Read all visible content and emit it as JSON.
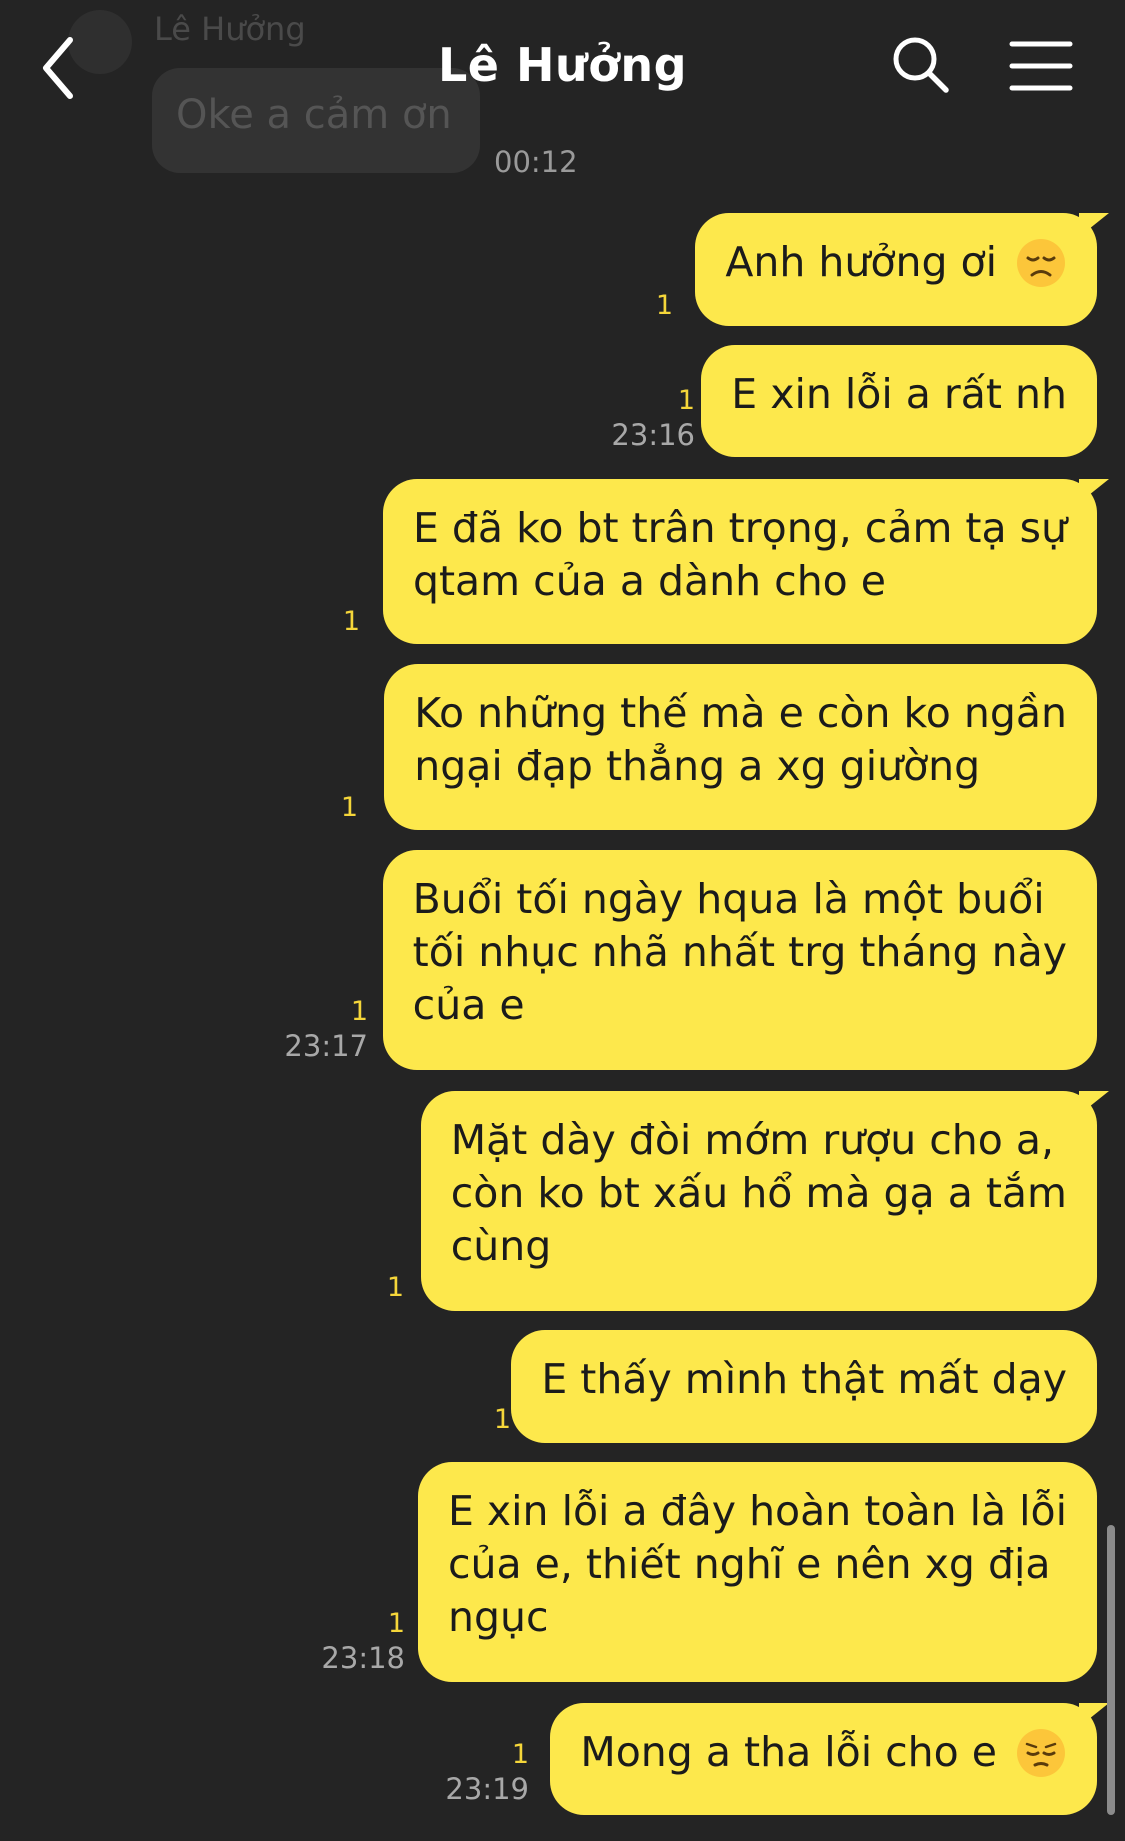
{
  "header": {
    "title": "Lê Hưởng",
    "back_icon": "chevron-left-icon",
    "search_icon": "search-icon",
    "menu_icon": "hamburger-menu-icon"
  },
  "previous_incoming": {
    "sender": "Lê Hưởng",
    "text": "Oke a cảm ơn",
    "time": "00:12"
  },
  "colors": {
    "background": "#242424",
    "outgoing_bubble": "#fde84c",
    "unread_count": "#f5d63a",
    "timestamp": "#a8a8a8"
  },
  "messages": [
    {
      "lines": [
        "Anh hưởng ơi"
      ],
      "emoji": "disappointed-face-emoji",
      "unread": "1",
      "time": ""
    },
    {
      "lines": [
        "E xin lỗi a rất nh"
      ],
      "unread": "1",
      "time": "23:16"
    },
    {
      "lines": [
        "E đã ko bt trân trọng, cảm tạ sự",
        "qtam của a dành cho e"
      ],
      "unread": "1",
      "time": ""
    },
    {
      "lines": [
        "Ko những thế mà e còn ko ngần",
        "ngại đạp thẳng a xg giường"
      ],
      "unread": "1",
      "time": ""
    },
    {
      "lines": [
        "Buổi tối ngày hqua là một buổi",
        "tối nhục nhã nhất trg tháng này",
        "của e"
      ],
      "unread": "1",
      "time": "23:17"
    },
    {
      "lines": [
        "Mặt dày đòi mớm rượu cho a,",
        "còn ko bt xấu hổ mà gạ a tắm",
        "cùng"
      ],
      "unread": "1",
      "time": ""
    },
    {
      "lines": [
        "E thấy mình thật mất dạy"
      ],
      "unread": "1",
      "time": ""
    },
    {
      "lines": [
        "E xin lỗi a đây hoàn toàn là lỗi",
        "của e, thiết nghĩ e nên xg địa",
        "ngục"
      ],
      "unread": "1",
      "time": "23:18"
    },
    {
      "lines": [
        "Mong a tha lỗi cho e"
      ],
      "emoji": "pensive-face-emoji",
      "unread": "1",
      "time": "23:19"
    }
  ]
}
